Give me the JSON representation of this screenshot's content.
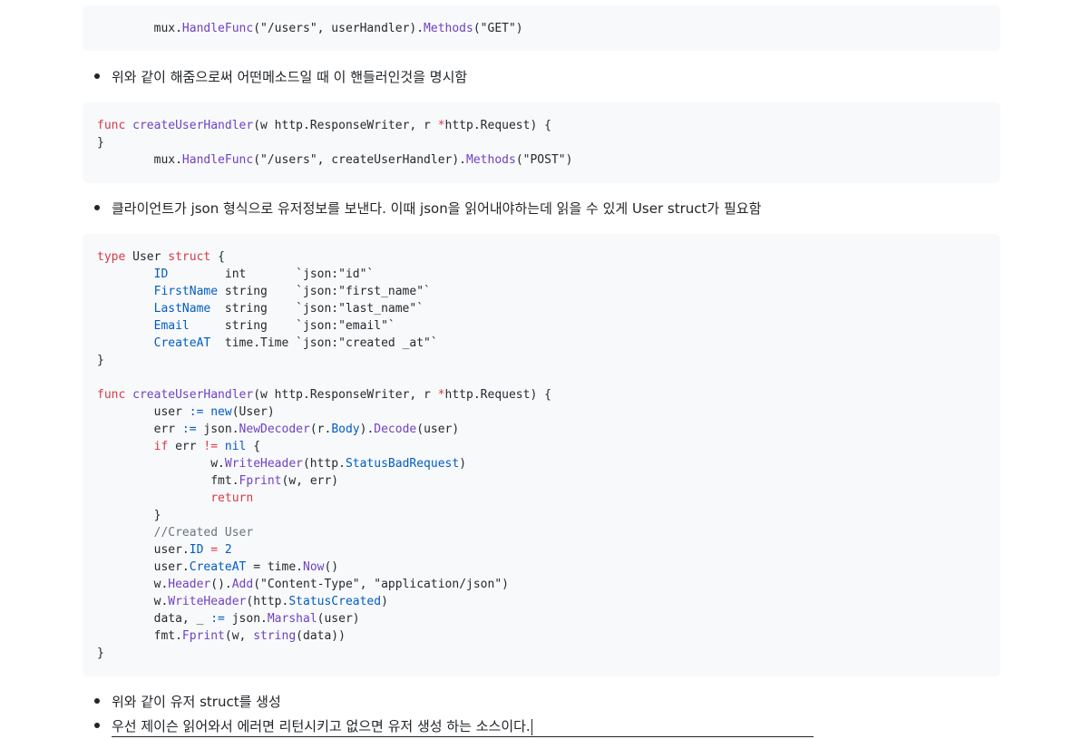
{
  "code_block_1": {
    "lines": [
      [
        "\t",
        {
          "t": "mux."
        },
        {
          "t": "HandleFunc",
          "c": "fn"
        },
        {
          "t": "(\"/users\", userHandler)."
        },
        {
          "t": "Methods",
          "c": "fn"
        },
        {
          "t": "(\"GET\")"
        }
      ]
    ]
  },
  "bullet_1": "위와 같이 해줌으로써 어떤메소드일 때 이 핸들러인것을 명시함",
  "code_block_2": {
    "lines": [
      [
        {
          "t": "func ",
          "c": "kw"
        },
        {
          "t": "createUserHandler",
          "c": "fn"
        },
        {
          "t": "(w http.ResponseWriter, r "
        },
        {
          "t": "*",
          "c": "kw"
        },
        {
          "t": "http.Request) {"
        }
      ],
      [
        {
          "t": "}"
        }
      ],
      [
        "\t",
        {
          "t": "mux."
        },
        {
          "t": "HandleFunc",
          "c": "fn"
        },
        {
          "t": "(\"/users\", createUserHandler)."
        },
        {
          "t": "Methods",
          "c": "fn"
        },
        {
          "t": "(\"POST\")"
        }
      ]
    ]
  },
  "bullet_2": "클라이언트가 json 형식으로 유저정보를 보낸다. 이때 json을 읽어내야하는데 읽을 수 있게 User struct가 필요함",
  "code_block_3": {
    "lines": [
      [
        {
          "t": "type ",
          "c": "kw"
        },
        {
          "t": "User "
        },
        {
          "t": "struct ",
          "c": "kw"
        },
        {
          "t": "{"
        }
      ],
      [
        "\t",
        {
          "t": "ID",
          "c": "id"
        },
        {
          "t": "        int       `json:\"id\"`"
        }
      ],
      [
        "\t",
        {
          "t": "FirstName",
          "c": "id"
        },
        {
          "t": " string    `json:\"first_name\"`"
        }
      ],
      [
        "\t",
        {
          "t": "LastName",
          "c": "id"
        },
        {
          "t": "  string    `json:\"last_name\"`"
        }
      ],
      [
        "\t",
        {
          "t": "Email",
          "c": "id"
        },
        {
          "t": "     string    `json:\"email\"`"
        }
      ],
      [
        "\t",
        {
          "t": "CreateAT",
          "c": "id"
        },
        {
          "t": "  time.Time `json:\"created _at\"`"
        }
      ],
      [
        {
          "t": "}"
        }
      ],
      [
        {
          "t": ""
        }
      ],
      [
        {
          "t": "func ",
          "c": "kw"
        },
        {
          "t": "createUserHandler",
          "c": "fn"
        },
        {
          "t": "(w http.ResponseWriter, r "
        },
        {
          "t": "*",
          "c": "kw"
        },
        {
          "t": "http.Request) {"
        }
      ],
      [
        "\t",
        {
          "t": "user "
        },
        {
          "t": ":= ",
          "c": "id"
        },
        {
          "t": "new",
          "c": "id"
        },
        {
          "t": "(User)"
        }
      ],
      [
        "\t",
        {
          "t": "err "
        },
        {
          "t": ":= ",
          "c": "id"
        },
        {
          "t": "json."
        },
        {
          "t": "NewDecoder",
          "c": "fn"
        },
        {
          "t": "(r."
        },
        {
          "t": "Body",
          "c": "id"
        },
        {
          "t": ")."
        },
        {
          "t": "Decode",
          "c": "fn"
        },
        {
          "t": "(user)"
        }
      ],
      [
        "\t",
        {
          "t": "if ",
          "c": "kw"
        },
        {
          "t": "err "
        },
        {
          "t": "!= ",
          "c": "kw"
        },
        {
          "t": "nil",
          "c": "id"
        },
        {
          "t": " {"
        }
      ],
      [
        "\t\t",
        {
          "t": "w."
        },
        {
          "t": "WriteHeader",
          "c": "fn"
        },
        {
          "t": "(http."
        },
        {
          "t": "StatusBadRequest",
          "c": "id"
        },
        {
          "t": ")"
        }
      ],
      [
        "\t\t",
        {
          "t": "fmt."
        },
        {
          "t": "Fprint",
          "c": "fn"
        },
        {
          "t": "(w, err)"
        }
      ],
      [
        "\t\t",
        {
          "t": "return",
          "c": "kw"
        }
      ],
      [
        "\t",
        {
          "t": "}"
        }
      ],
      [
        "\t",
        {
          "t": "//Created User",
          "c": "cm"
        }
      ],
      [
        "\t",
        {
          "t": "user."
        },
        {
          "t": "ID",
          "c": "id"
        },
        {
          "t": " = ",
          "c": "kw"
        },
        {
          "t": "2",
          "c": "id"
        }
      ],
      [
        "\t",
        {
          "t": "user."
        },
        {
          "t": "CreateAT",
          "c": "id"
        },
        {
          "t": " = time."
        },
        {
          "t": "Now",
          "c": "fn"
        },
        {
          "t": "()"
        }
      ],
      [
        "\t",
        {
          "t": "w."
        },
        {
          "t": "Header",
          "c": "fn"
        },
        {
          "t": "()."
        },
        {
          "t": "Add",
          "c": "fn"
        },
        {
          "t": "(\"Content-Type\", \"application/json\")"
        }
      ],
      [
        "\t",
        {
          "t": "w."
        },
        {
          "t": "WriteHeader",
          "c": "fn"
        },
        {
          "t": "(http."
        },
        {
          "t": "StatusCreated",
          "c": "id"
        },
        {
          "t": ")"
        }
      ],
      [
        "\t",
        {
          "t": "data, _ "
        },
        {
          "t": ":= ",
          "c": "id"
        },
        {
          "t": "json."
        },
        {
          "t": "Marshal",
          "c": "fn"
        },
        {
          "t": "(user)"
        }
      ],
      [
        "\t",
        {
          "t": "fmt."
        },
        {
          "t": "Fprint",
          "c": "fn"
        },
        {
          "t": "(w, "
        },
        {
          "t": "string",
          "c": "fn"
        },
        {
          "t": "(data))"
        }
      ],
      [
        {
          "t": "}"
        }
      ]
    ]
  },
  "bullet_3": "위와 같이 유저 struct를 생성",
  "bullet_4": "우선 제이슨 읽어와서 에러면 리턴시키고 없으면 유저 생성 하는 소스이다."
}
